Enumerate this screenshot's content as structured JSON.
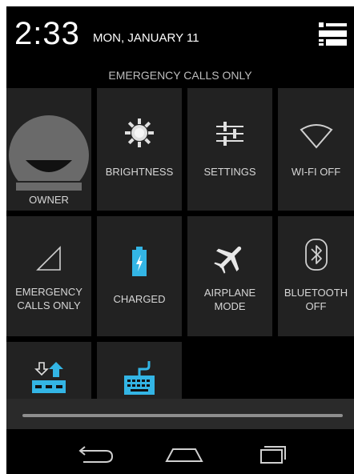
{
  "header": {
    "time": "2:33",
    "date": "MON, JANUARY 11",
    "status": "EMERGENCY CALLS ONLY"
  },
  "tiles": {
    "owner": "OWNER",
    "brightness": "BRIGHTNESS",
    "settings": "SETTINGS",
    "wifi": "WI-FI OFF",
    "signal_line1": "EMERGENCY",
    "signal_line2": "CALLS ONLY",
    "battery": "CHARGED",
    "airplane_line1": "AIRPLANE",
    "airplane_line2": "MODE",
    "bluetooth_line1": "BLUETOOTH",
    "bluetooth_line2": "OFF"
  },
  "colors": {
    "accent": "#33b5e5",
    "tile_bg": "#222222",
    "text": "#d6d6d6"
  },
  "icons": [
    "settings-list-icon",
    "sun-icon",
    "sliders-icon",
    "wifi-icon",
    "signal-icon",
    "battery-icon",
    "airplane-icon",
    "bluetooth-icon",
    "usb-transfer-icon",
    "keyboard-icon",
    "back-icon",
    "home-icon",
    "recents-icon"
  ]
}
